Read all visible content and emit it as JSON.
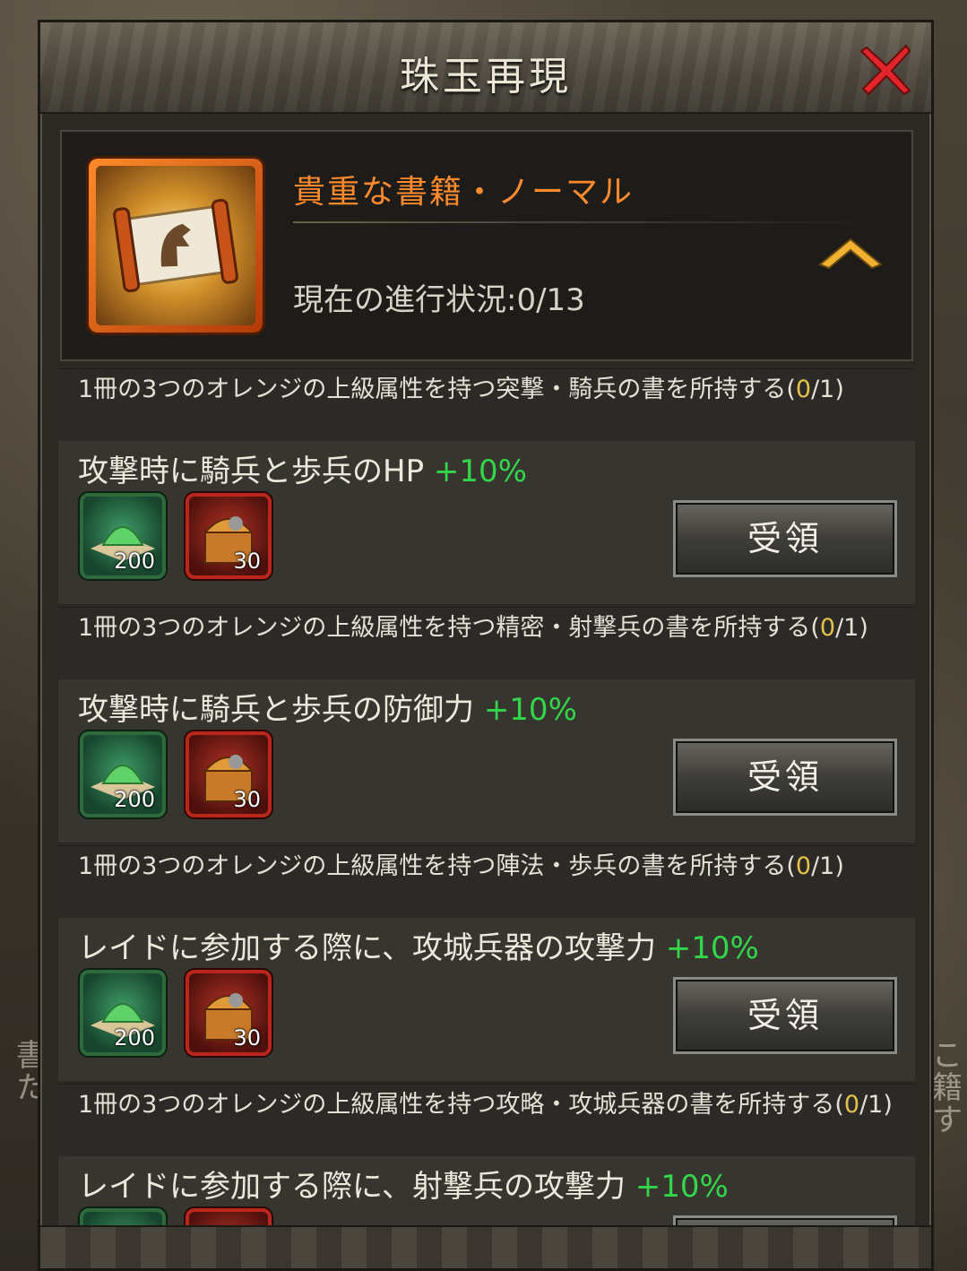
{
  "window": {
    "title": "珠玉再現"
  },
  "background": {
    "left_text": "書\nた",
    "right_text": "こ\n籍\nす"
  },
  "summary": {
    "name": "貴重な書籍・ノーマル",
    "progress_label": "現在の進行状況:0/13"
  },
  "colors": {
    "accent_orange": "#ff8a2e",
    "bonus_green": "#33d64a",
    "progress_yellow": "#e2c24a"
  },
  "tasks": [
    {
      "req_before": "1冊の3つのオレンジの上級属性を持つ突撃・騎兵の書を所持する(",
      "req_num": "0",
      "req_after": "/1)",
      "bonus_text": "攻撃時に騎兵と歩兵のHP ",
      "bonus_pct": "+10%",
      "reward_green_count": "200",
      "reward_red_count": "30",
      "claim_label": "受領"
    },
    {
      "req_before": "1冊の3つのオレンジの上級属性を持つ精密・射撃兵の書を所持する(",
      "req_num": "0",
      "req_after": "/1)",
      "bonus_text": "攻撃時に騎兵と歩兵の防御力 ",
      "bonus_pct": "+10%",
      "reward_green_count": "200",
      "reward_red_count": "30",
      "claim_label": "受領"
    },
    {
      "req_before": "1冊の3つのオレンジの上級属性を持つ陣法・歩兵の書を所持する(",
      "req_num": "0",
      "req_after": "/1)",
      "bonus_text": "レイドに参加する際に、攻城兵器の攻撃力 ",
      "bonus_pct": "+10%",
      "reward_green_count": "200",
      "reward_red_count": "30",
      "claim_label": "受領"
    },
    {
      "req_before": "1冊の3つのオレンジの上級属性を持つ攻略・攻城兵器の書を所持する(",
      "req_num": "0",
      "req_after": "/1)",
      "bonus_text": "レイドに参加する際に、射撃兵の攻撃力 ",
      "bonus_pct": "+10%",
      "reward_green_count": "",
      "reward_red_count": "",
      "claim_label": ""
    }
  ]
}
